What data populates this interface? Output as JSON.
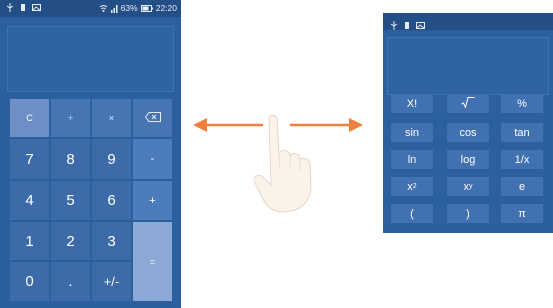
{
  "status_bar": {
    "battery": "63%",
    "time": "22:20"
  },
  "basic_keypad": {
    "clear": "C",
    "divide": "÷",
    "multiply": "×",
    "digits": [
      "7",
      "8",
      "9",
      "4",
      "5",
      "6",
      "1",
      "2",
      "3",
      "0"
    ],
    "minus": "-",
    "plus": "+",
    "equals": "=",
    "dot": ".",
    "plus_minus": "+/-"
  },
  "scientific_keypad": {
    "factorial": "X!",
    "percent": "%",
    "sin": "sin",
    "cos": "cos",
    "tan": "tan",
    "ln": "ln",
    "log": "log",
    "reciprocal": "1/x",
    "square_base": "x",
    "square_exp": "2",
    "power_base": "x",
    "power_exp": "y",
    "e": "e",
    "open_paren": "(",
    "close_paren": ")",
    "pi": "π"
  },
  "colors": {
    "phone_bg": "#2c5f9e",
    "arrow": "#ee7f3c"
  }
}
